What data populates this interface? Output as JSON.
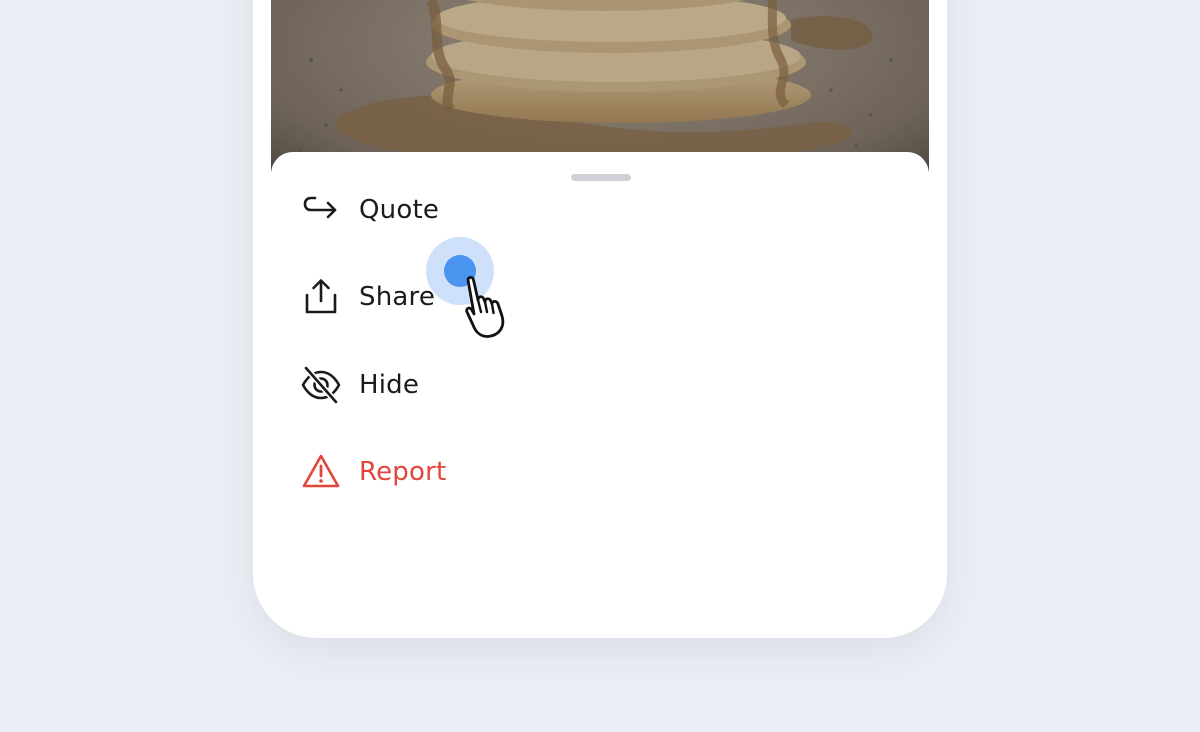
{
  "menu": {
    "items": [
      {
        "label": "Quote",
        "icon": "quote-arrow-icon",
        "color": "#1b1b1f"
      },
      {
        "label": "Share",
        "icon": "share-icon",
        "color": "#1b1b1f"
      },
      {
        "label": "Hide",
        "icon": "eye-off-icon",
        "color": "#1b1b1f"
      },
      {
        "label": "Report",
        "icon": "warning-icon",
        "color": "#e2453c"
      }
    ]
  },
  "colors": {
    "background": "#eceef5",
    "sheet": "#ffffff",
    "danger": "#e2453c",
    "tap_accent": "#4a93ee"
  },
  "photo": {
    "subject": "stack-of-pancakes"
  }
}
